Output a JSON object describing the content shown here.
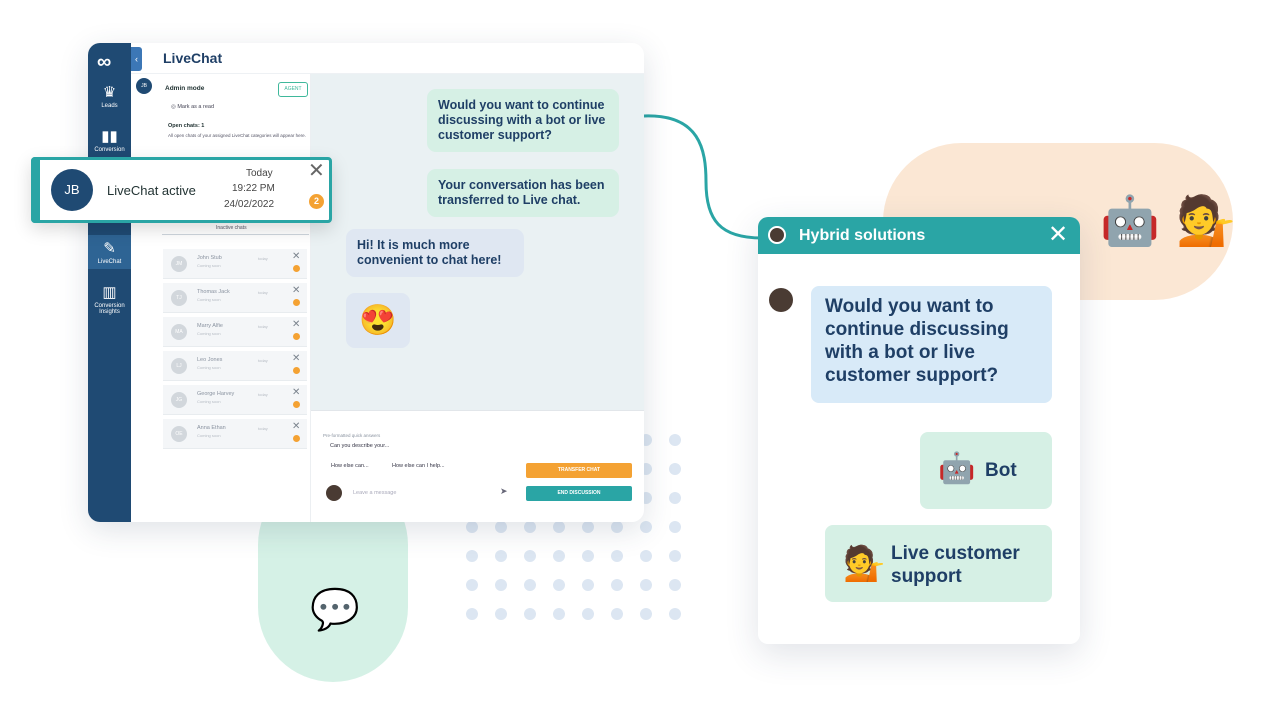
{
  "app": {
    "title": "LiveChat",
    "logo_symbol": "∞",
    "collapse_icon": "‹",
    "rail": [
      {
        "label": "Leads",
        "icon": "leads-icon",
        "glyph": "♛"
      },
      {
        "label": "Conversion",
        "icon": "conversion-icon",
        "glyph": "▮▮"
      },
      {
        "label": "LiveChat",
        "icon": "livechat-icon",
        "glyph": "✎"
      },
      {
        "label": "Conversion Insights",
        "icon": "insights-icon",
        "glyph": "▥"
      }
    ],
    "panel": {
      "avatar_initials": "JB",
      "admin_mode": "Admin mode",
      "agent_badge": "AGENT",
      "mark_read": "Mark as a read",
      "open_chats": "Open chats: 1",
      "open_desc": "All open chats of your assigned LiveChat categories will appear here.",
      "inactive_label": "Inactive chats",
      "inactive_chats": [
        {
          "initials": "JM",
          "name": "John Stub",
          "sub": "Coming soon",
          "time": "today"
        },
        {
          "initials": "TJ",
          "name": "Thomas Jack",
          "sub": "Coming soon",
          "time": "today"
        },
        {
          "initials": "MA",
          "name": "Marry Alfie",
          "sub": "Coming soon",
          "time": "today"
        },
        {
          "initials": "LJ",
          "name": "Leo Jones",
          "sub": "Coming soon",
          "time": "today"
        },
        {
          "initials": "JG",
          "name": "George Harvey",
          "sub": "Coming soon",
          "time": "today"
        },
        {
          "initials": "OE",
          "name": "Anna Ethan",
          "sub": "Coming soon",
          "time": "today"
        }
      ]
    },
    "conversation": {
      "messages": [
        {
          "text": "Would you want to continue discussing with a bot or live customer support?"
        },
        {
          "text": "Your conversation has been transferred to Live chat."
        },
        {
          "text": "Hi! It is much more convenient to chat here!"
        },
        {
          "text": "😍"
        }
      ],
      "quick_replies_title": "Pre-formatted quick answers",
      "quick_replies": [
        "Can you describe your...",
        "How else can...",
        "How else can I help..."
      ],
      "composer_placeholder": "Leave a message",
      "send_icon": "➤",
      "transfer_label": "TRANSFER CHAT",
      "end_label": "END DISCUSSION"
    }
  },
  "notification": {
    "initials": "JB",
    "title": "LiveChat active",
    "day": "Today",
    "time": "19:22 PM",
    "date": "24/02/2022",
    "count": "2",
    "close": "✕"
  },
  "widget": {
    "title": "Hybrid solutions",
    "close": "✕",
    "question": "Would you want to continue discussing with a bot or live customer support?",
    "options": [
      {
        "label": "Bot",
        "icon": "robot-icon",
        "glyph": "🤖"
      },
      {
        "label": "Live customer support",
        "icon": "person-tipping-hand-icon",
        "glyph": "💁"
      }
    ]
  },
  "decor": {
    "speech_glyph": "💬",
    "robot_glyph": "🤖",
    "person_glyph": "💁"
  },
  "colors": {
    "rail": "#1f4a73",
    "teal": "#2aa5a5",
    "orange": "#f4a233",
    "text_dark": "#1f3f66"
  }
}
